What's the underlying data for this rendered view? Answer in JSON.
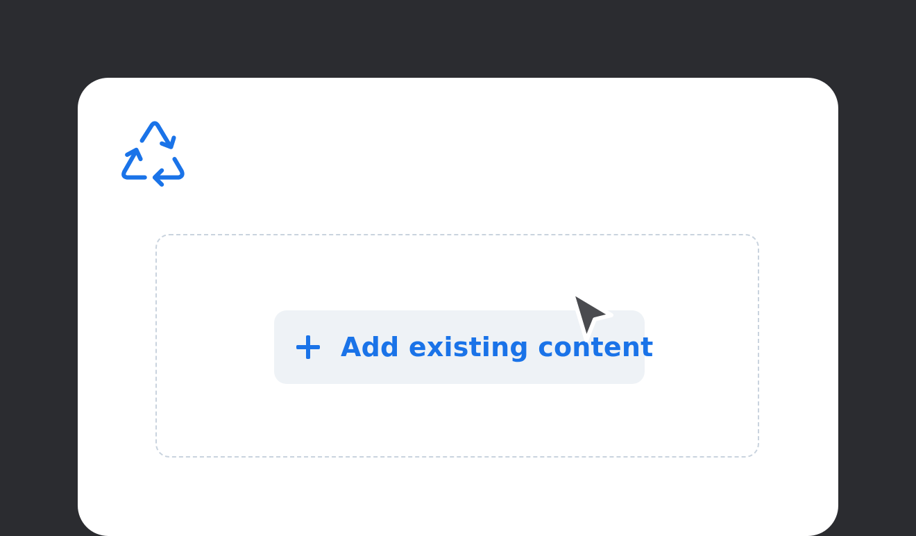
{
  "icons": {
    "logo": "recycle-icon",
    "add": "plus-icon",
    "pointer": "mouse-pointer-icon"
  },
  "colors": {
    "background": "#2b2c30",
    "card": "#ffffff",
    "accent": "#1a73e8",
    "button_bg": "#eef2f6",
    "dashed_border": "#c9d3de",
    "cursor": "#4a4b4f"
  },
  "dropzone": {
    "add_button": {
      "label": "Add existing content"
    }
  }
}
